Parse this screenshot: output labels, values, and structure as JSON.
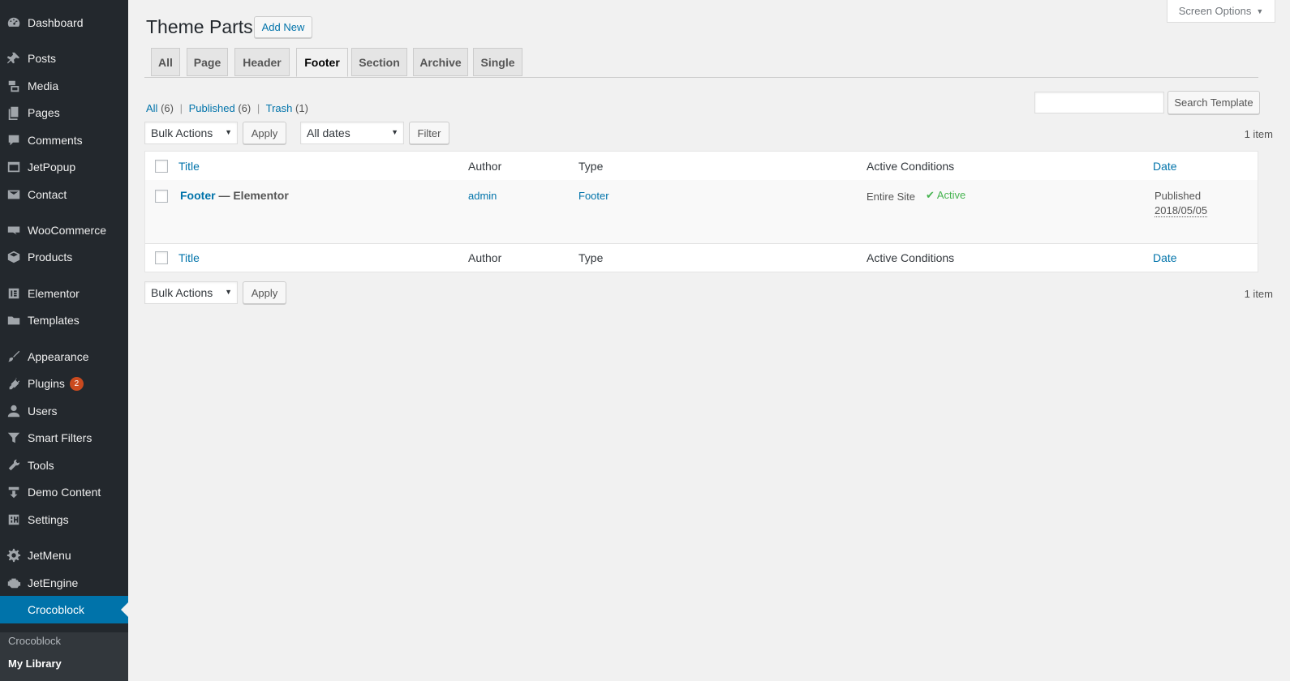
{
  "sidebar": {
    "items": [
      {
        "label": "Dashboard",
        "icon": "dashboard-icon"
      },
      {
        "label": "Posts",
        "icon": "pin-icon"
      },
      {
        "label": "Media",
        "icon": "media-icon"
      },
      {
        "label": "Pages",
        "icon": "pages-icon"
      },
      {
        "label": "Comments",
        "icon": "comment-icon"
      },
      {
        "label": "JetPopup",
        "icon": "popup-icon"
      },
      {
        "label": "Contact",
        "icon": "envelope-icon"
      },
      {
        "label": "WooCommerce",
        "icon": "woo-icon"
      },
      {
        "label": "Products",
        "icon": "box-icon"
      },
      {
        "label": "Elementor",
        "icon": "elementor-icon"
      },
      {
        "label": "Templates",
        "icon": "folder-icon"
      },
      {
        "label": "Appearance",
        "icon": "brush-icon"
      },
      {
        "label": "Plugins",
        "icon": "plug-icon",
        "badge": "2"
      },
      {
        "label": "Users",
        "icon": "user-icon"
      },
      {
        "label": "Smart Filters",
        "icon": "filter-icon"
      },
      {
        "label": "Tools",
        "icon": "wrench-icon"
      },
      {
        "label": "Demo Content",
        "icon": "download-icon"
      },
      {
        "label": "Settings",
        "icon": "settings-icon"
      },
      {
        "label": "JetMenu",
        "icon": "gear-icon"
      },
      {
        "label": "JetEngine",
        "icon": "engine-icon"
      },
      {
        "label": "Crocoblock",
        "icon": "crocoblock-icon"
      }
    ],
    "submenu": [
      "Crocoblock",
      "My Library"
    ]
  },
  "header": {
    "title": "Theme Parts",
    "add_new": "Add New",
    "screen_options": "Screen Options"
  },
  "tabs": [
    "All",
    "Page",
    "Header",
    "Footer",
    "Section",
    "Archive",
    "Single"
  ],
  "active_tab": "Footer",
  "views": {
    "all": "All",
    "all_count": "(6)",
    "published": "Published",
    "published_count": "(6)",
    "trash": "Trash",
    "trash_count": "(1)",
    "separator": "|"
  },
  "toolbar": {
    "bulk_actions": "Bulk Actions",
    "apply": "Apply",
    "all_dates": "All dates",
    "filter": "Filter",
    "search_button": "Search Template",
    "items_count": "1 item"
  },
  "table": {
    "columns": [
      "Title",
      "Author",
      "Type",
      "Active Conditions",
      "Date"
    ],
    "rows": [
      {
        "title": "Footer",
        "title_suffix": " — Elementor",
        "author": "admin",
        "type": "Footer",
        "condition": "Entire Site",
        "status": "Active",
        "date_status": "Published",
        "date": "2018/05/05"
      }
    ]
  },
  "colors": {
    "sidebar_bg": "#23282d",
    "accent": "#0073aa",
    "badge": "#ca4a1f",
    "active_green": "#46b450"
  }
}
